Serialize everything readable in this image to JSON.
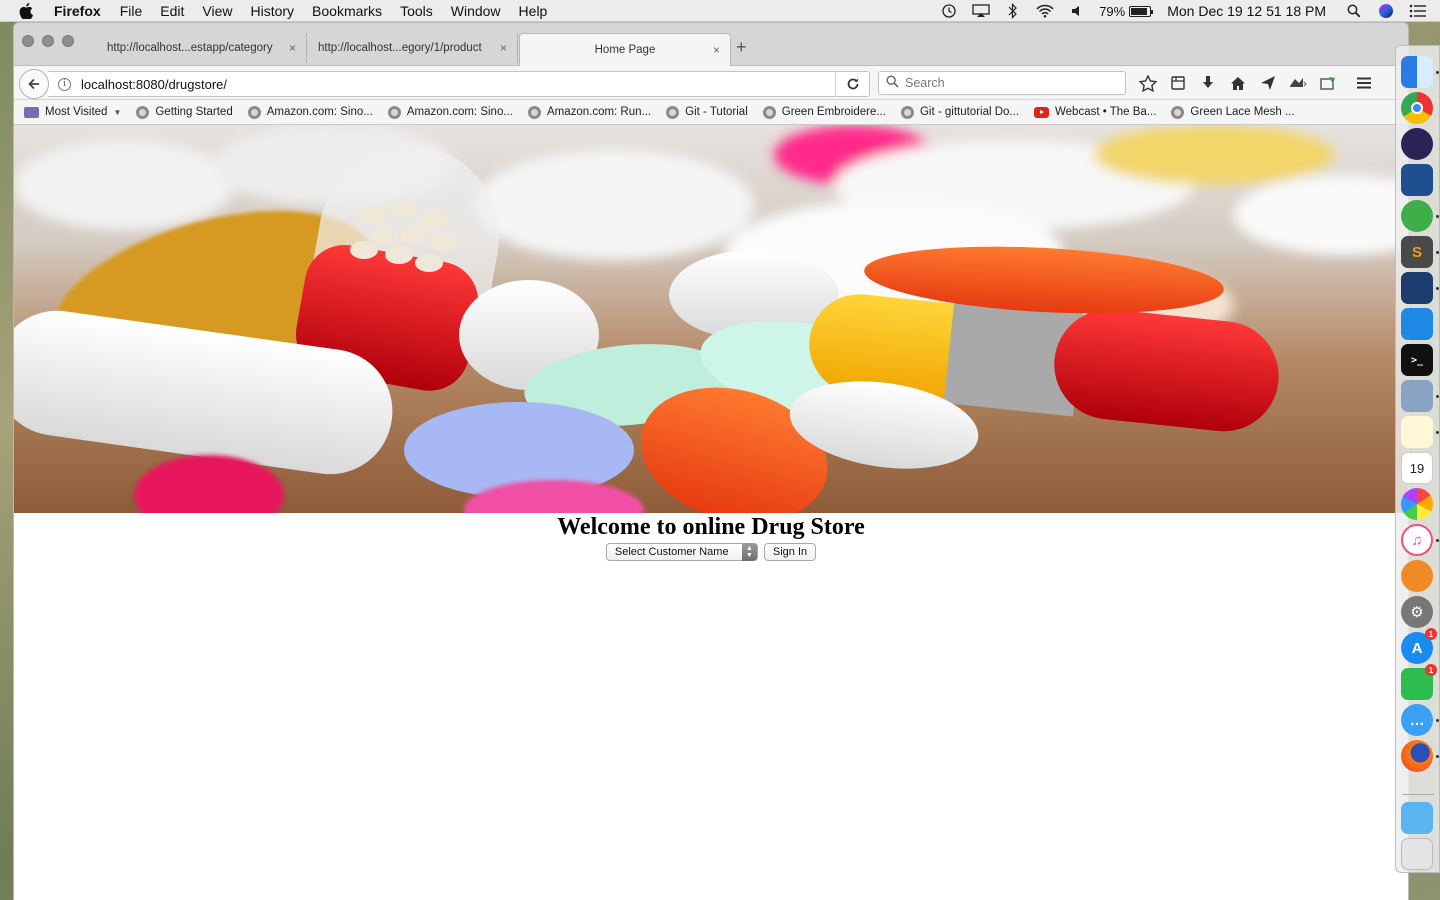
{
  "menubar": {
    "app_name": "Firefox",
    "items": [
      "File",
      "Edit",
      "View",
      "History",
      "Bookmarks",
      "Tools",
      "Window",
      "Help"
    ],
    "battery_percent": "79%",
    "clock": "Mon Dec 19  12 51 18 PM"
  },
  "tabs": [
    {
      "title": "http://localhost...estapp/category",
      "close": "×"
    },
    {
      "title": "http://localhost...egory/1/product",
      "close": "×"
    },
    {
      "title": "Home Page",
      "close": "×"
    }
  ],
  "new_tab": "+",
  "navbar": {
    "url": "localhost:8080/drugstore/",
    "search_placeholder": "Search"
  },
  "bookmarks": [
    {
      "label": "Most Visited",
      "icon": "folder-icon"
    },
    {
      "label": "Getting Started",
      "icon": "globe-icon"
    },
    {
      "label": "Amazon.com: Sino...",
      "icon": "globe-icon"
    },
    {
      "label": "Amazon.com: Sino...",
      "icon": "globe-icon"
    },
    {
      "label": "Amazon.com: Run...",
      "icon": "globe-icon"
    },
    {
      "label": "Git - Tutorial",
      "icon": "globe-icon"
    },
    {
      "label": "Green Embroidere...",
      "icon": "globe-icon"
    },
    {
      "label": "Git - gittutorial Do...",
      "icon": "globe-icon"
    },
    {
      "label": "Webcast • The Ba...",
      "icon": "youtube-icon"
    },
    {
      "label": "Green Lace Mesh ...",
      "icon": "globe-icon"
    }
  ],
  "page": {
    "heading": "Welcome to online Drug Store",
    "select_value": "Select Customer Name",
    "signin_label": "Sign In"
  },
  "dock": {
    "calendar_day": "19",
    "appstore_badge": "1",
    "facetime_badge": "1"
  }
}
